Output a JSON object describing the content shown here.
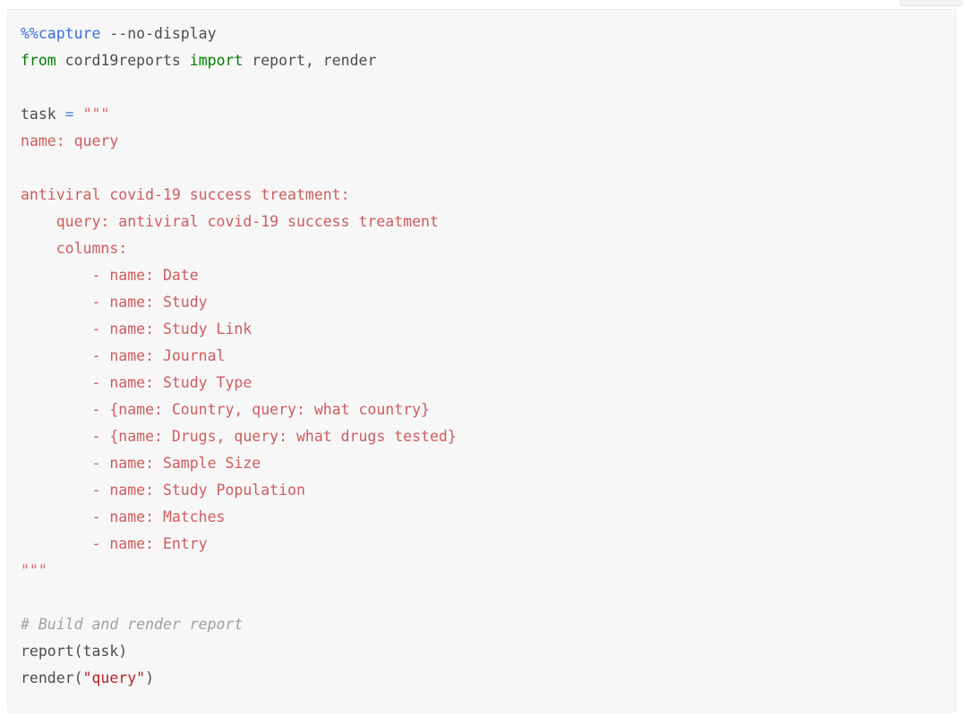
{
  "window": {
    "title": "Jupyter notebook code cell",
    "background_color": "#ffffff"
  },
  "toolbar_fragment": {
    "name": "clipped-toolbar",
    "visible_label": ""
  },
  "cell": {
    "type": "code",
    "background_color": "#f7f7f7",
    "border_color": "#efefef",
    "font_size_px": 16.5,
    "line_height_px": 30
  },
  "colors": {
    "magic": "#3a6fd8",
    "keyword": "#008000",
    "plain_identifier": "#4d4d4d",
    "operator": "#4a86e8",
    "triple_quote": "#d96a6a",
    "yaml_body": "#cf5c5c",
    "string": "#ba2121",
    "comment": "#a0a0a0"
  },
  "code": {
    "lines": [
      {
        "id": "l1",
        "tokens": [
          {
            "t": "%%capture",
            "c": "magic"
          },
          {
            "t": " --no-display",
            "c": "plain"
          }
        ]
      },
      {
        "id": "l2",
        "tokens": [
          {
            "t": "from",
            "c": "keyword"
          },
          {
            "t": " cord19reports ",
            "c": "plain"
          },
          {
            "t": "import",
            "c": "keyword"
          },
          {
            "t": " report, render",
            "c": "plain"
          }
        ]
      },
      {
        "id": "l3",
        "tokens": []
      },
      {
        "id": "l4",
        "tokens": [
          {
            "t": "task ",
            "c": "plain"
          },
          {
            "t": "=",
            "c": "operator"
          },
          {
            "t": " ",
            "c": "plain"
          },
          {
            "t": "\"\"\"",
            "c": "tripq"
          }
        ]
      },
      {
        "id": "l5",
        "tokens": [
          {
            "t": "name: query",
            "c": "yaml"
          }
        ]
      },
      {
        "id": "l6",
        "tokens": []
      },
      {
        "id": "l7",
        "tokens": [
          {
            "t": "antiviral covid-19 success treatment:",
            "c": "yaml"
          }
        ]
      },
      {
        "id": "l8",
        "tokens": [
          {
            "t": "    query: antiviral covid-19 success treatment",
            "c": "yaml"
          }
        ]
      },
      {
        "id": "l9",
        "tokens": [
          {
            "t": "    columns:",
            "c": "yaml"
          }
        ]
      },
      {
        "id": "l10",
        "tokens": [
          {
            "t": "        - name: Date",
            "c": "yaml"
          }
        ]
      },
      {
        "id": "l11",
        "tokens": [
          {
            "t": "        - name: Study",
            "c": "yaml"
          }
        ]
      },
      {
        "id": "l12",
        "tokens": [
          {
            "t": "        - name: Study Link",
            "c": "yaml"
          }
        ]
      },
      {
        "id": "l13",
        "tokens": [
          {
            "t": "        - name: Journal",
            "c": "yaml"
          }
        ]
      },
      {
        "id": "l14",
        "tokens": [
          {
            "t": "        - name: Study Type",
            "c": "yaml"
          }
        ]
      },
      {
        "id": "l15",
        "tokens": [
          {
            "t": "        - {name: Country, query: what country}",
            "c": "yaml"
          }
        ]
      },
      {
        "id": "l16",
        "tokens": [
          {
            "t": "        - {name: Drugs, query: what drugs tested}",
            "c": "yaml"
          }
        ]
      },
      {
        "id": "l17",
        "tokens": [
          {
            "t": "        - name: Sample Size",
            "c": "yaml"
          }
        ]
      },
      {
        "id": "l18",
        "tokens": [
          {
            "t": "        - name: Study Population",
            "c": "yaml"
          }
        ]
      },
      {
        "id": "l19",
        "tokens": [
          {
            "t": "        - name: Matches",
            "c": "yaml"
          }
        ]
      },
      {
        "id": "l20",
        "tokens": [
          {
            "t": "        - name: Entry",
            "c": "yaml"
          }
        ]
      },
      {
        "id": "l21",
        "tokens": [
          {
            "t": "\"\"\"",
            "c": "tripq"
          }
        ]
      },
      {
        "id": "l22",
        "tokens": []
      },
      {
        "id": "l23",
        "tokens": [
          {
            "t": "# Build and render report",
            "c": "comment"
          }
        ]
      },
      {
        "id": "l24",
        "tokens": [
          {
            "t": "report(task)",
            "c": "plain"
          }
        ]
      },
      {
        "id": "l25",
        "tokens": [
          {
            "t": "render(",
            "c": "plain"
          },
          {
            "t": "\"query\"",
            "c": "string"
          },
          {
            "t": ")",
            "c": "plain"
          }
        ]
      }
    ]
  }
}
